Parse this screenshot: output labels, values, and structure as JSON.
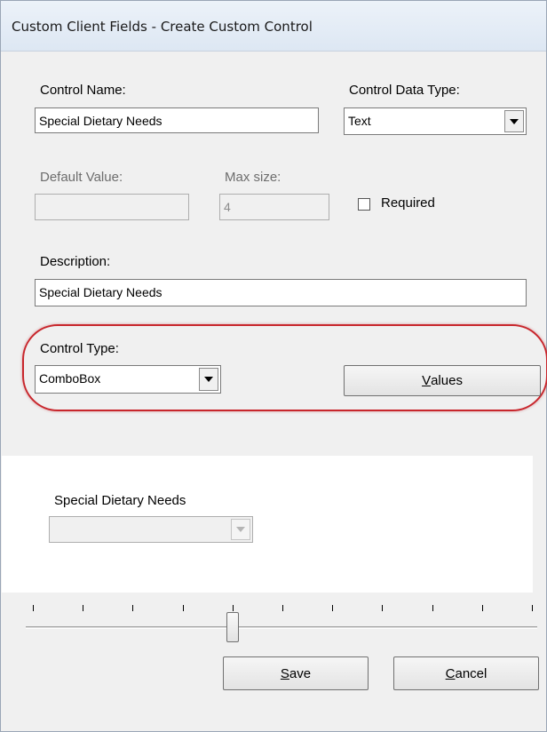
{
  "window": {
    "title": "Custom Client Fields - Create Custom Control"
  },
  "control_name": {
    "label": "Control Name:",
    "value": "Special Dietary Needs"
  },
  "control_data_type": {
    "label": "Control Data Type:",
    "value": "Text"
  },
  "default_value": {
    "label": "Default Value:",
    "value": ""
  },
  "max_size": {
    "label": "Max size:",
    "value": "4"
  },
  "required": {
    "label": "Required",
    "checked": false
  },
  "description": {
    "label": "Description:",
    "value": "Special Dietary Needs"
  },
  "control_type": {
    "label": "Control Type:",
    "value": "ComboBox"
  },
  "values_button": {
    "mnemonic": "V",
    "rest": "alues"
  },
  "preview": {
    "label": "Special Dietary Needs",
    "value": ""
  },
  "slider": {
    "ticks": 11,
    "position": 4
  },
  "save_button": {
    "mnemonic": "S",
    "rest": "ave"
  },
  "cancel_button": {
    "mnemonic": "C",
    "rest": "ancel"
  },
  "colors": {
    "highlight": "#c8262c",
    "window_bg": "#f0f0f0"
  },
  "icons": {
    "dropdown": "chevron-down-icon"
  }
}
